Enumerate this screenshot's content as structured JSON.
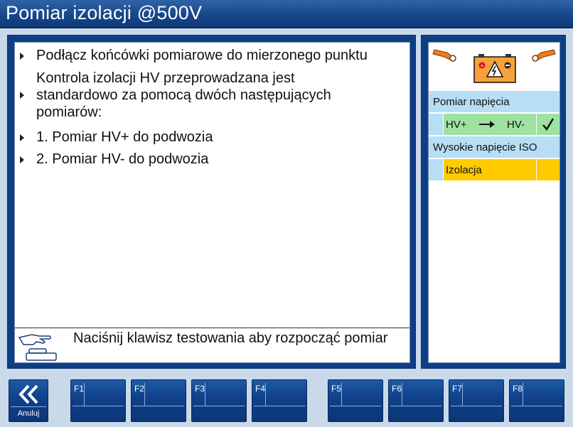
{
  "window": {
    "title": "Pomiar izolacji @500V"
  },
  "instructions": {
    "bullets": [
      "Podłącz końcówki pomiarowe do mierzonego punktu",
      "Kontrola izolacji HV przeprowadzana jest standardowo za pomocą dwóch następujących pomiarów:",
      "1. Pomiar HV+ do podwozia",
      "2. Pomiar HV- do podwozia"
    ],
    "hint": "Naciśnij klawisz testowania aby rozpocząć pomiar"
  },
  "status_panel": {
    "voltage_heading": "Pomiar napięcia",
    "voltage_step": {
      "from": "HV+",
      "to": "HV-",
      "status": "done",
      "color": "#9ee2a0"
    },
    "iso_heading": "Wysokie napięcie ISO",
    "iso_step": {
      "label": "Izolacja",
      "status": "active",
      "color": "#ffca00"
    }
  },
  "function_keys": {
    "cancel_label": "Anuluj",
    "keys": [
      "F1",
      "F2",
      "F3",
      "F4",
      "F5",
      "F6",
      "F7",
      "F8"
    ]
  },
  "icons": {
    "title_icon": "none",
    "hint": "hand-press-button-icon",
    "panel": "hv-battery-with-probes-icon",
    "step_done": "check-icon",
    "cancel": "double-chevron-left-icon"
  }
}
